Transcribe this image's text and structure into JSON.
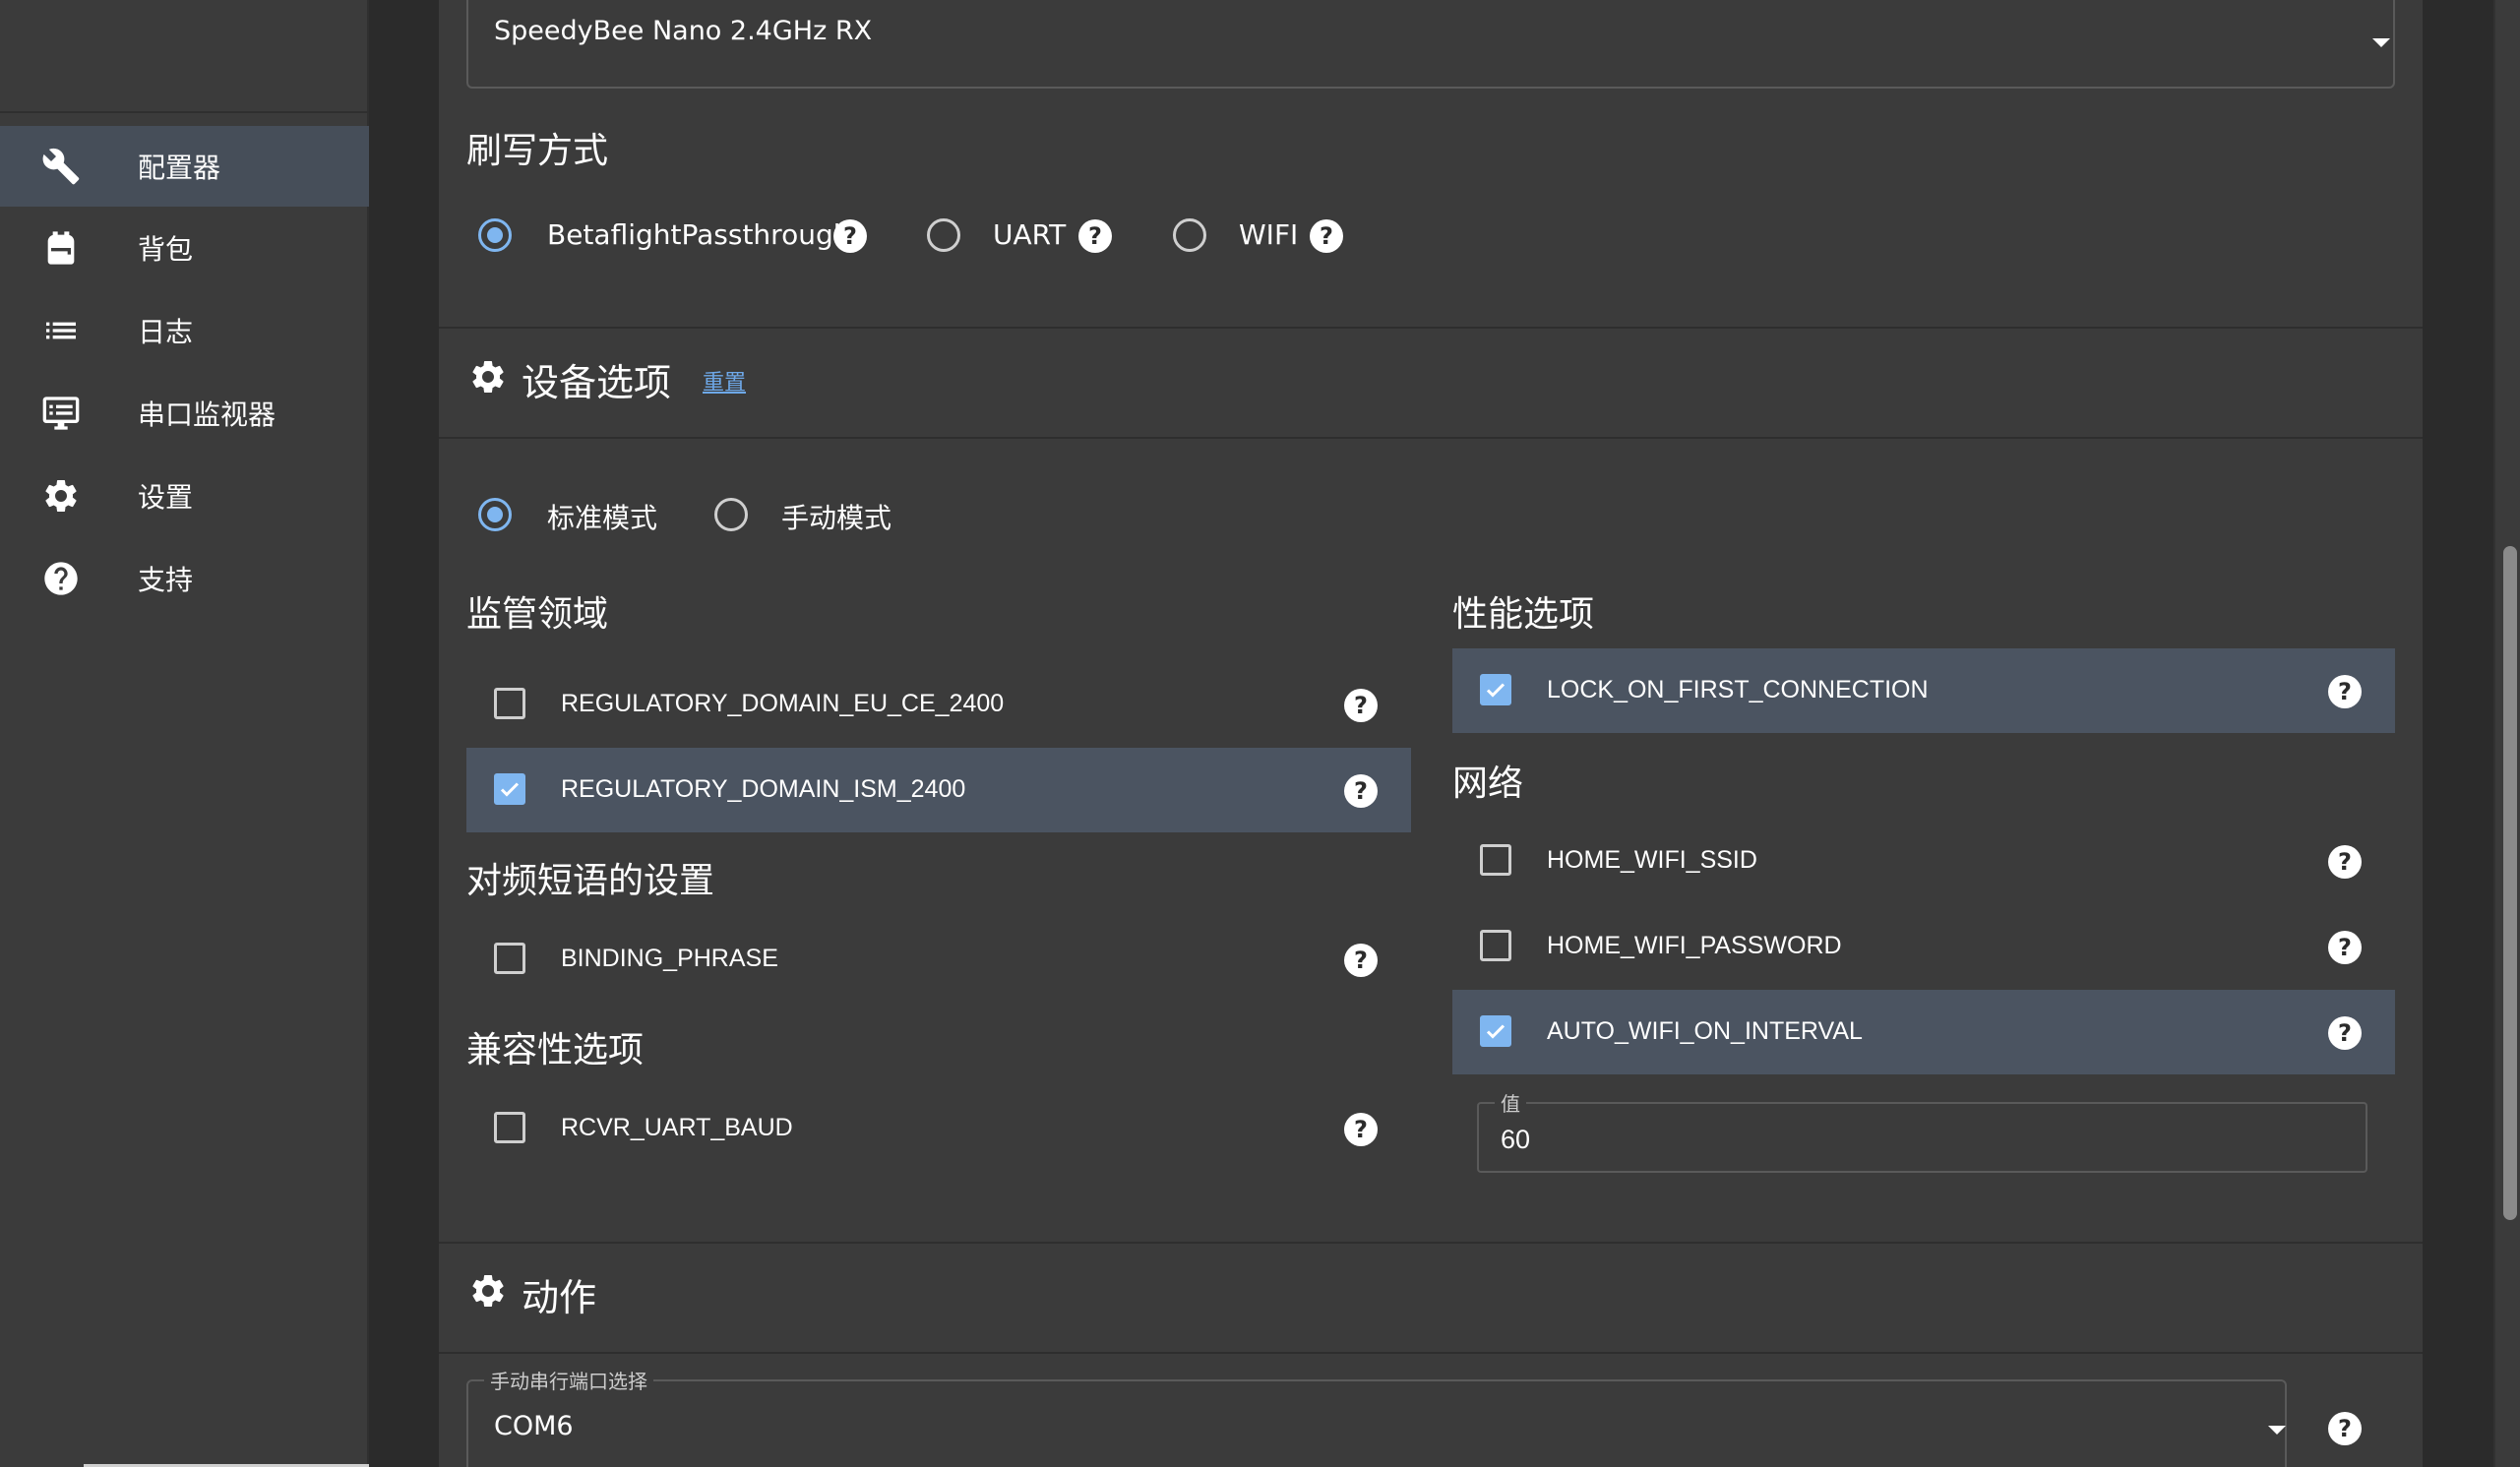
{
  "sidebar": {
    "items": [
      {
        "label": "配置器",
        "icon": "wrench-icon",
        "active": true
      },
      {
        "label": "背包",
        "icon": "backpack-icon",
        "active": false
      },
      {
        "label": "日志",
        "icon": "list-icon",
        "active": false
      },
      {
        "label": "串口监视器",
        "icon": "monitor-icon",
        "active": false
      },
      {
        "label": "设置",
        "icon": "gear-icon",
        "active": false
      },
      {
        "label": "支持",
        "icon": "help-circle-icon",
        "active": false
      }
    ]
  },
  "receiver": {
    "selected": "SpeedyBee Nano 2.4GHz RX"
  },
  "flash_method": {
    "title": "刷写方式",
    "options": [
      {
        "label": "BetaflightPassthrough",
        "checked": true
      },
      {
        "label": "UART",
        "checked": false
      },
      {
        "label": "WIFI",
        "checked": false
      }
    ]
  },
  "device_options": {
    "title": "设备选项",
    "reset_label": "重置",
    "modes": [
      {
        "label": "标准模式",
        "checked": true
      },
      {
        "label": "手动模式",
        "checked": false
      }
    ],
    "regulatory": {
      "title": "监管领域",
      "options": [
        {
          "label": "REGULATORY_DOMAIN_EU_CE_2400",
          "checked": false
        },
        {
          "label": "REGULATORY_DOMAIN_ISM_2400",
          "checked": true
        }
      ]
    },
    "binding": {
      "title": "对频短语的设置",
      "options": [
        {
          "label": "BINDING_PHRASE",
          "checked": false
        }
      ]
    },
    "compat": {
      "title": "兼容性选项",
      "options": [
        {
          "label": "RCVR_UART_BAUD",
          "checked": false
        }
      ]
    },
    "performance": {
      "title": "性能选项",
      "options": [
        {
          "label": "LOCK_ON_FIRST_CONNECTION",
          "checked": true
        }
      ]
    },
    "network": {
      "title": "网络",
      "options": [
        {
          "label": "HOME_WIFI_SSID",
          "checked": false
        },
        {
          "label": "HOME_WIFI_PASSWORD",
          "checked": false
        },
        {
          "label": "AUTO_WIFI_ON_INTERVAL",
          "checked": true
        }
      ],
      "value_label": "值",
      "value": "60"
    }
  },
  "actions": {
    "title": "动作",
    "port_label": "手动串行端口选择",
    "port_value": "COM6"
  },
  "colors": {
    "accent": "#7fb6f0",
    "selected_row": "#4b5461",
    "panel": "#3b3b3b"
  }
}
